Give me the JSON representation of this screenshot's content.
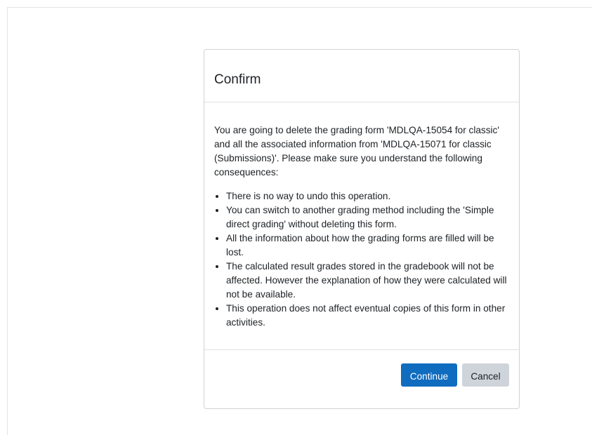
{
  "dialog": {
    "title": "Confirm",
    "intro": "You are going to delete the grading form 'MDLQA-15054 for classic' and all the associated information from 'MDLQA-15071 for classic (Submissions)'. Please make sure you understand the following consequences:",
    "consequences": [
      "There is no way to undo this operation.",
      "You can switch to another grading method including the 'Simple direct grading' without deleting this form.",
      "All the information about how the grading forms are filled will be lost.",
      "The calculated result grades stored in the gradebook will not be affected. However the explanation of how they were calculated will not be available.",
      "This operation does not affect eventual copies of this form in other activities."
    ],
    "continue_label": "Continue",
    "cancel_label": "Cancel"
  },
  "colors": {
    "primary": "#0f6cbf",
    "secondary": "#ced4da",
    "text": "#1d2125"
  }
}
